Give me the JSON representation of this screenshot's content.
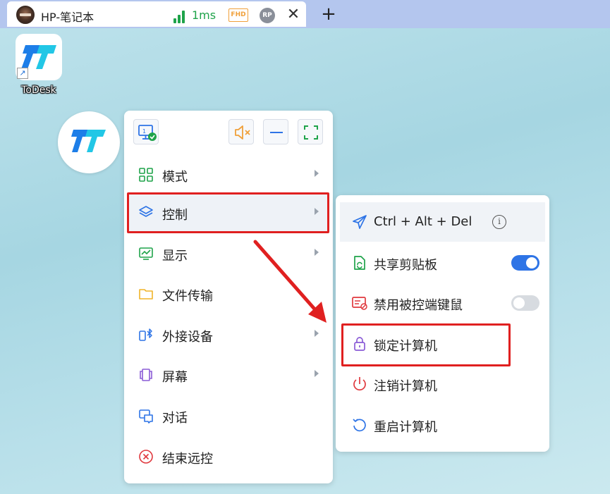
{
  "tab": {
    "title": "HP-笔记本",
    "latency": "1ms",
    "quality_badge": "FHD",
    "user_badge": "RP",
    "close_glyph": "✕"
  },
  "new_tab_glyph": "+",
  "desktop": {
    "shortcut_label": "ToDesk"
  },
  "colors": {
    "accent_blue": "#2e74e6",
    "highlight_red": "#e02020",
    "signal_green": "#1fa34a",
    "fhd_orange": "#f0a03a"
  },
  "menu": {
    "toolbar": [
      "monitor-check-icon",
      "speaker-mute-icon",
      "minimize-icon",
      "fullscreen-icon"
    ],
    "items": [
      {
        "label": "模式",
        "icon": "grid-icon",
        "has_submenu": true
      },
      {
        "label": "控制",
        "icon": "layers-icon",
        "has_submenu": true
      },
      {
        "label": "显示",
        "icon": "monitor-chart-icon",
        "has_submenu": true
      },
      {
        "label": "文件传输",
        "icon": "folder-icon",
        "has_submenu": false
      },
      {
        "label": "外接设备",
        "icon": "bluetooth-device-icon",
        "has_submenu": true
      },
      {
        "label": "屏幕",
        "icon": "screens-icon",
        "has_submenu": true
      },
      {
        "label": "对话",
        "icon": "chat-icon",
        "has_submenu": false
      },
      {
        "label": "结束远控",
        "icon": "close-circle-icon",
        "has_submenu": false
      }
    ]
  },
  "submenu": {
    "items": [
      {
        "label": "Ctrl + Alt + Del",
        "icon": "send-icon",
        "info": "i"
      },
      {
        "label": "共享剪贴板",
        "icon": "clipboard-sync-icon",
        "toggle": "on"
      },
      {
        "label": "禁用被控端键鼠",
        "icon": "keyboard-block-icon",
        "toggle": "off"
      },
      {
        "label": "锁定计算机",
        "icon": "lock-icon"
      },
      {
        "label": "注销计算机",
        "icon": "power-icon"
      },
      {
        "label": "重启计算机",
        "icon": "restart-icon"
      }
    ]
  }
}
